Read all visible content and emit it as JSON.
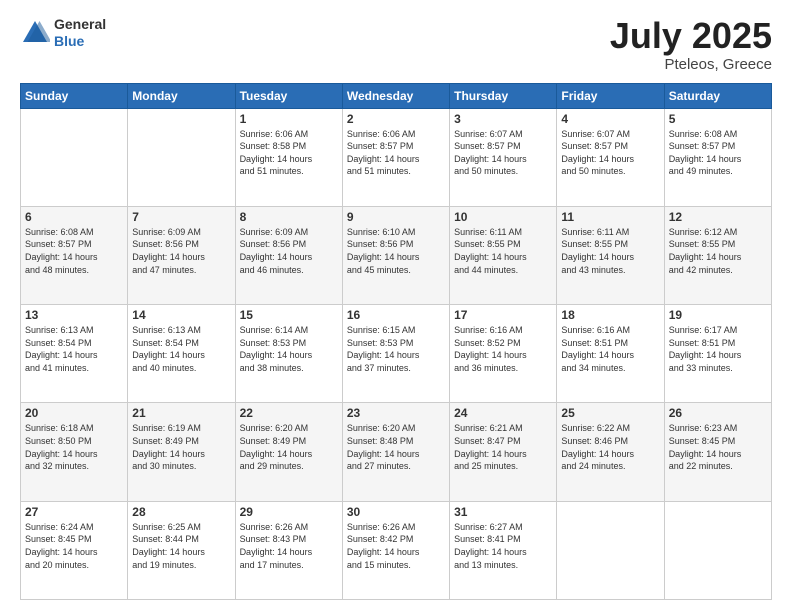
{
  "logo": {
    "line1": "General",
    "line2": "Blue"
  },
  "title": "July 2025",
  "subtitle": "Pteleos, Greece",
  "days_header": [
    "Sunday",
    "Monday",
    "Tuesday",
    "Wednesday",
    "Thursday",
    "Friday",
    "Saturday"
  ],
  "weeks": [
    [
      {
        "day": "",
        "info": ""
      },
      {
        "day": "",
        "info": ""
      },
      {
        "day": "1",
        "info": "Sunrise: 6:06 AM\nSunset: 8:58 PM\nDaylight: 14 hours\nand 51 minutes."
      },
      {
        "day": "2",
        "info": "Sunrise: 6:06 AM\nSunset: 8:57 PM\nDaylight: 14 hours\nand 51 minutes."
      },
      {
        "day": "3",
        "info": "Sunrise: 6:07 AM\nSunset: 8:57 PM\nDaylight: 14 hours\nand 50 minutes."
      },
      {
        "day": "4",
        "info": "Sunrise: 6:07 AM\nSunset: 8:57 PM\nDaylight: 14 hours\nand 50 minutes."
      },
      {
        "day": "5",
        "info": "Sunrise: 6:08 AM\nSunset: 8:57 PM\nDaylight: 14 hours\nand 49 minutes."
      }
    ],
    [
      {
        "day": "6",
        "info": "Sunrise: 6:08 AM\nSunset: 8:57 PM\nDaylight: 14 hours\nand 48 minutes."
      },
      {
        "day": "7",
        "info": "Sunrise: 6:09 AM\nSunset: 8:56 PM\nDaylight: 14 hours\nand 47 minutes."
      },
      {
        "day": "8",
        "info": "Sunrise: 6:09 AM\nSunset: 8:56 PM\nDaylight: 14 hours\nand 46 minutes."
      },
      {
        "day": "9",
        "info": "Sunrise: 6:10 AM\nSunset: 8:56 PM\nDaylight: 14 hours\nand 45 minutes."
      },
      {
        "day": "10",
        "info": "Sunrise: 6:11 AM\nSunset: 8:55 PM\nDaylight: 14 hours\nand 44 minutes."
      },
      {
        "day": "11",
        "info": "Sunrise: 6:11 AM\nSunset: 8:55 PM\nDaylight: 14 hours\nand 43 minutes."
      },
      {
        "day": "12",
        "info": "Sunrise: 6:12 AM\nSunset: 8:55 PM\nDaylight: 14 hours\nand 42 minutes."
      }
    ],
    [
      {
        "day": "13",
        "info": "Sunrise: 6:13 AM\nSunset: 8:54 PM\nDaylight: 14 hours\nand 41 minutes."
      },
      {
        "day": "14",
        "info": "Sunrise: 6:13 AM\nSunset: 8:54 PM\nDaylight: 14 hours\nand 40 minutes."
      },
      {
        "day": "15",
        "info": "Sunrise: 6:14 AM\nSunset: 8:53 PM\nDaylight: 14 hours\nand 38 minutes."
      },
      {
        "day": "16",
        "info": "Sunrise: 6:15 AM\nSunset: 8:53 PM\nDaylight: 14 hours\nand 37 minutes."
      },
      {
        "day": "17",
        "info": "Sunrise: 6:16 AM\nSunset: 8:52 PM\nDaylight: 14 hours\nand 36 minutes."
      },
      {
        "day": "18",
        "info": "Sunrise: 6:16 AM\nSunset: 8:51 PM\nDaylight: 14 hours\nand 34 minutes."
      },
      {
        "day": "19",
        "info": "Sunrise: 6:17 AM\nSunset: 8:51 PM\nDaylight: 14 hours\nand 33 minutes."
      }
    ],
    [
      {
        "day": "20",
        "info": "Sunrise: 6:18 AM\nSunset: 8:50 PM\nDaylight: 14 hours\nand 32 minutes."
      },
      {
        "day": "21",
        "info": "Sunrise: 6:19 AM\nSunset: 8:49 PM\nDaylight: 14 hours\nand 30 minutes."
      },
      {
        "day": "22",
        "info": "Sunrise: 6:20 AM\nSunset: 8:49 PM\nDaylight: 14 hours\nand 29 minutes."
      },
      {
        "day": "23",
        "info": "Sunrise: 6:20 AM\nSunset: 8:48 PM\nDaylight: 14 hours\nand 27 minutes."
      },
      {
        "day": "24",
        "info": "Sunrise: 6:21 AM\nSunset: 8:47 PM\nDaylight: 14 hours\nand 25 minutes."
      },
      {
        "day": "25",
        "info": "Sunrise: 6:22 AM\nSunset: 8:46 PM\nDaylight: 14 hours\nand 24 minutes."
      },
      {
        "day": "26",
        "info": "Sunrise: 6:23 AM\nSunset: 8:45 PM\nDaylight: 14 hours\nand 22 minutes."
      }
    ],
    [
      {
        "day": "27",
        "info": "Sunrise: 6:24 AM\nSunset: 8:45 PM\nDaylight: 14 hours\nand 20 minutes."
      },
      {
        "day": "28",
        "info": "Sunrise: 6:25 AM\nSunset: 8:44 PM\nDaylight: 14 hours\nand 19 minutes."
      },
      {
        "day": "29",
        "info": "Sunrise: 6:26 AM\nSunset: 8:43 PM\nDaylight: 14 hours\nand 17 minutes."
      },
      {
        "day": "30",
        "info": "Sunrise: 6:26 AM\nSunset: 8:42 PM\nDaylight: 14 hours\nand 15 minutes."
      },
      {
        "day": "31",
        "info": "Sunrise: 6:27 AM\nSunset: 8:41 PM\nDaylight: 14 hours\nand 13 minutes."
      },
      {
        "day": "",
        "info": ""
      },
      {
        "day": "",
        "info": ""
      }
    ]
  ]
}
